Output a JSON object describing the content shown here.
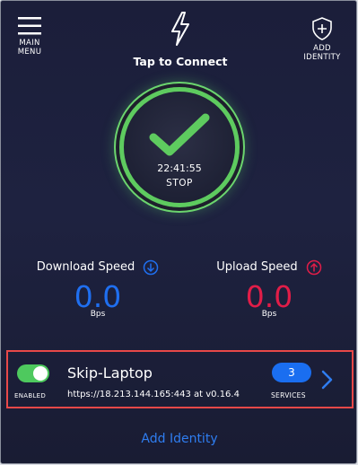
{
  "header": {
    "menu_label_line1": "MAIN",
    "menu_label_line2": "MENU",
    "connect_label": "Tap to Connect",
    "add_identity_line1": "ADD",
    "add_identity_line2": "IDENTITY"
  },
  "status": {
    "timer": "22:41:55",
    "stop_label": "STOP"
  },
  "download": {
    "title": "Download Speed",
    "value": "0.0",
    "unit": "Bps",
    "color": "#1f6ff0"
  },
  "upload": {
    "title": "Upload Speed",
    "value": "0.0",
    "unit": "Bps",
    "color": "#e11d48"
  },
  "identity": {
    "enabled_label": "ENABLED",
    "name": "Skip-Laptop",
    "url": "https://18.213.144.165:443 at v0.16.4",
    "services_count": "3",
    "services_label": "SERVICES"
  },
  "footer": {
    "add_identity": "Add Identity"
  },
  "colors": {
    "accent": "#5ecb5f",
    "link": "#2f7df0",
    "highlight_border": "#e84848"
  }
}
